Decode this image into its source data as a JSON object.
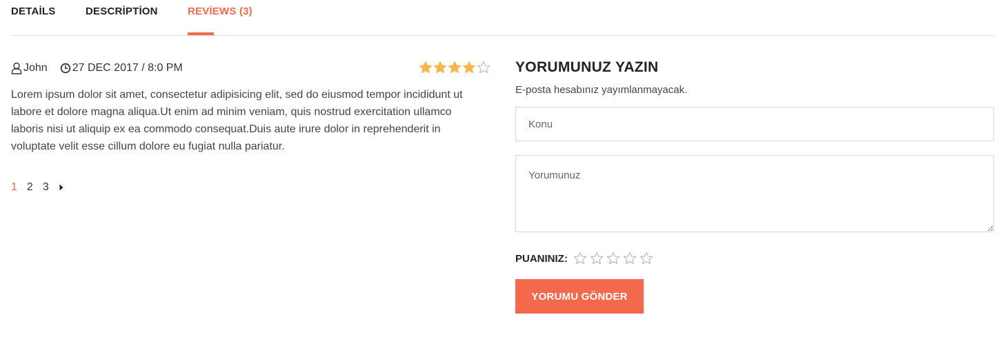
{
  "tabs": [
    {
      "label": "DETAİLS"
    },
    {
      "label": "DESCRİPTİON"
    },
    {
      "label": "REVİEWS (3)"
    }
  ],
  "accent_color": "#f4694b",
  "review": {
    "author": "John",
    "date": "27 DEC 2017 / 8:0 PM",
    "rating": 4,
    "rating_max": 5,
    "text": "Lorem ipsum dolor sit amet, consectetur adipisicing elit, sed do eiusmod tempor incididunt ut labore et dolore magna aliqua.Ut enim ad minim veniam, quis nostrud exercitation ullamco laboris nisi ut aliquip ex ea commodo consequat.Duis aute irure dolor in reprehenderit in voluptate velit esse cillum dolore eu fugiat nulla pariatur."
  },
  "pagination": {
    "pages": [
      "1",
      "2",
      "3"
    ],
    "current": "1"
  },
  "form": {
    "title": "YORUMUNUZ YAZIN",
    "note": "E-posta hesabınız yayımlanmayacak.",
    "subject_placeholder": "Konu",
    "comment_placeholder": "Yorumunuz",
    "rating_label": "PUANINIZ:",
    "submit_label": "YORUMU GÖNDER"
  }
}
